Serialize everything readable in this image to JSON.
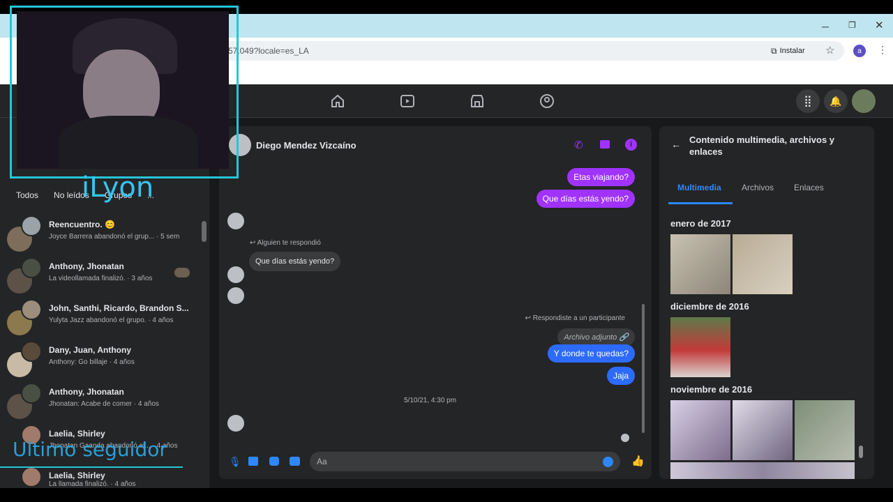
{
  "browser": {
    "url_fragment": "57.049?locale=es_LA",
    "install_label": "Instalar",
    "profile_initial": "a"
  },
  "overlay": {
    "streamer_name": "iLyon",
    "last_follower_label": "Ultimo seguidor"
  },
  "chat_list": {
    "filters": [
      "Todos",
      "No leídos",
      "Grupos",
      "..."
    ],
    "items": [
      {
        "name": "Reencuentro. 😊",
        "preview": "Joyce Barrera abandonó el grup... · 5 sem"
      },
      {
        "name": "Anthony, Jhonatan",
        "preview": "La videollamada finalizó. · 3 años"
      },
      {
        "name": "John, Santhi, Ricardo, Brandon S...",
        "preview": "Yulyta Jazz abandonó el grupo. · 4 años"
      },
      {
        "name": "Dany, Juan, Anthony",
        "preview": "Anthony: Go billaje · 4 años"
      },
      {
        "name": "Anthony, Jhonatan",
        "preview": "Jhonatan: Acabe de comer · 4 años"
      },
      {
        "name": "Laelia, Shirley",
        "preview": "Jhonatan Gaanda abandonó el... · 4 años"
      },
      {
        "name": "Laelia, Shirley",
        "preview": "La llamada finalizó. · 4 años"
      }
    ]
  },
  "conversation": {
    "contact_name": "Diego Mendez Vizcaíno",
    "messages": {
      "out1": "Etas viajando?",
      "out2": "Que días estás yendo?",
      "reply_note": "Alguien te respondió",
      "in1": "Que días estás yendo?",
      "reply_note2": "Respondiste a un participante",
      "attachment": "Archivo adjunto",
      "out3": "Y donde te quedas?",
      "out4": "Jaja",
      "timestamp": "5/10/21, 4:30 pm"
    },
    "composer_placeholder": "Aa"
  },
  "media_panel": {
    "title": "Contenido multimedia, archivos y enlaces",
    "tabs": [
      "Multimedia",
      "Archivos",
      "Enlaces"
    ],
    "active_tab": "Multimedia",
    "months": [
      "enero de 2017",
      "diciembre de 2016",
      "noviembre de 2016"
    ]
  },
  "colors": {
    "accent_purple": "#a033ff",
    "accent_blue": "#2d88ff",
    "fb_dark": "#242526",
    "overlay_cyan": "#25c6d8"
  }
}
